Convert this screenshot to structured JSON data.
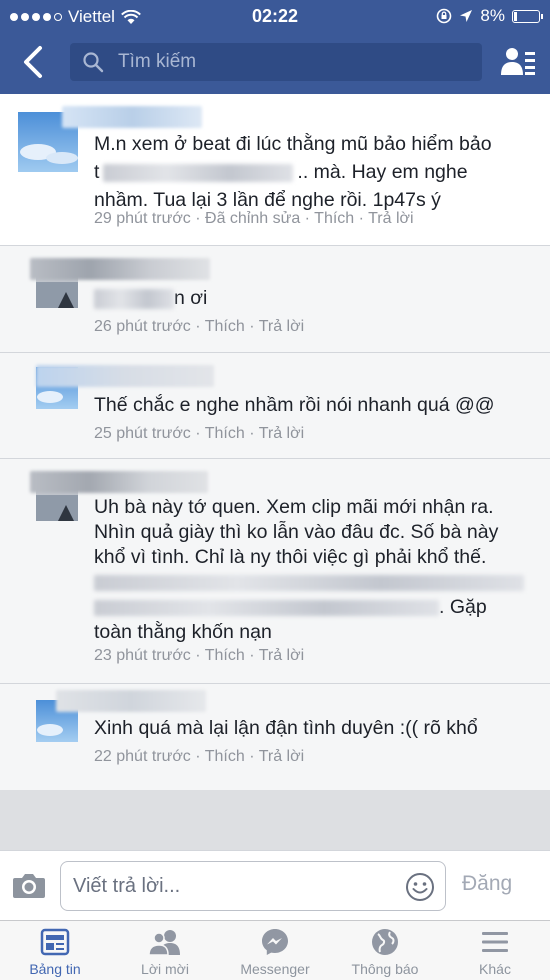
{
  "status_bar": {
    "carrier": "Viettel",
    "time": "02:22",
    "battery": "8%"
  },
  "header": {
    "search_placeholder": "Tìm kiếm",
    "back_icon": "chevron-left-icon",
    "friends_icon": "friend-list-icon"
  },
  "comments": [
    {
      "text_a": "M.n xem ở beat đi lúc thằng mũ bảo hiểm bảo",
      "text_b_prefix": "t",
      "text_b_suffix": ".. mà. Hay em nghe",
      "text_c": "nhầm. Tua lại 3 lần để nghe rồi. 1p47s ý",
      "time": "29 phút trước",
      "edited": "Đã chỉnh sửa",
      "like": "Thích",
      "reply": "Trả lời"
    },
    {
      "text_suffix": "n ơi",
      "time": "26 phút trước",
      "like": "Thích",
      "reply": "Trả lời"
    },
    {
      "text": "Thế chắc e nghe nhầm rồi nói nhanh quá @@",
      "time": "25 phút trước",
      "like": "Thích",
      "reply": "Trả lời"
    },
    {
      "line1": "Uh bà này tớ quen. Xem clip mãi mới nhận ra.",
      "line2": "Nhìn quả giày thì ko lẫn vào đâu đc. Số bà này",
      "line3": "khổ vì tình. Chỉ là ny thôi việc gì phải khổ thế.",
      "line5_suffix": ". Gặp",
      "line6": "toàn thằng khốn nạn",
      "time": "23 phút trước",
      "like": "Thích",
      "reply": "Trả lời"
    },
    {
      "text": "Xinh quá mà lại lận đận tình duyên :(( rõ khổ",
      "time": "22 phút trước",
      "like": "Thích",
      "reply": "Trả lời"
    }
  ],
  "reply_bar": {
    "placeholder": "Viết trả lời...",
    "post_label": "Đăng"
  },
  "tabs": [
    {
      "label": "Bảng tin",
      "icon": "news-feed-icon",
      "active": true
    },
    {
      "label": "Lời mời",
      "icon": "friend-requests-icon",
      "active": false
    },
    {
      "label": "Messenger",
      "icon": "messenger-icon",
      "active": false
    },
    {
      "label": "Thông báo",
      "icon": "globe-icon",
      "active": false
    },
    {
      "label": "Khác",
      "icon": "menu-icon",
      "active": false
    }
  ],
  "colors": {
    "header": "#3b5998",
    "accent": "#4267b2",
    "meta_text": "#90949c"
  }
}
